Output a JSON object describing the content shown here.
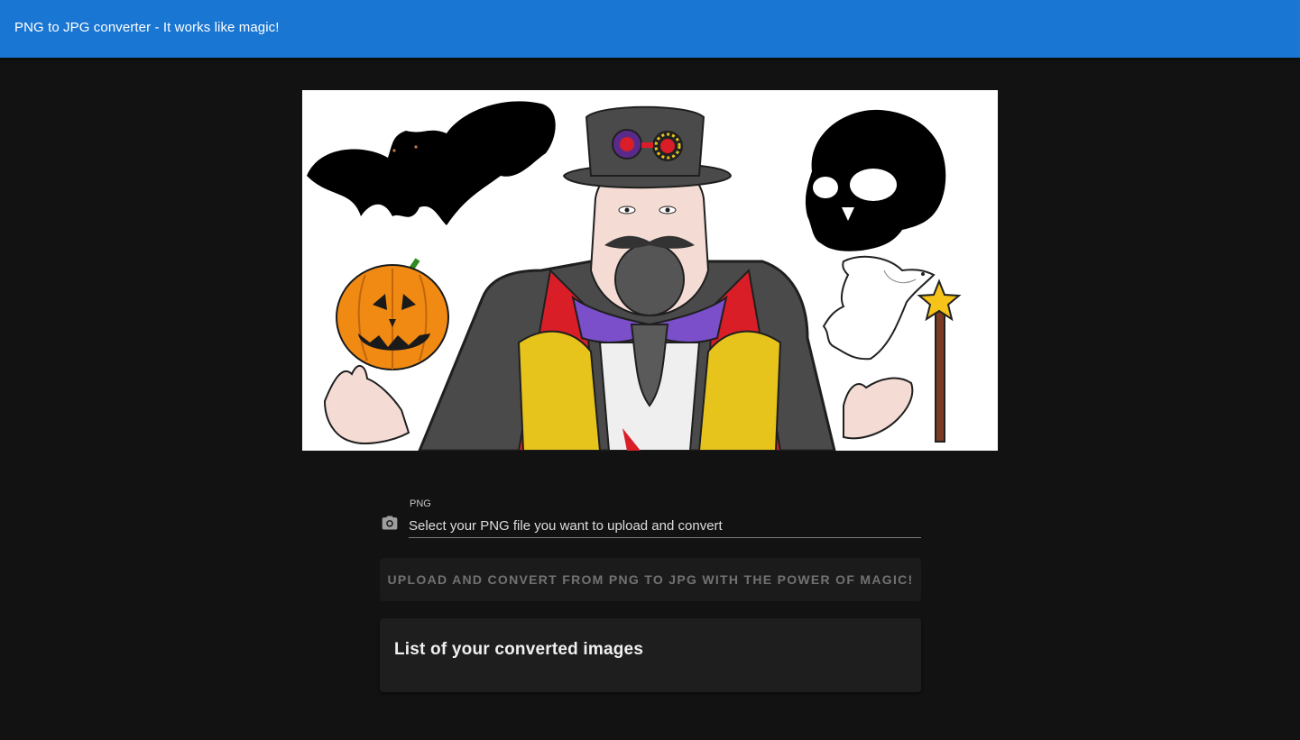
{
  "app": {
    "title": "PNG to JPG converter - It works like magic!"
  },
  "hero": {
    "alt": "Magician illustration with bat, skull, pumpkin, dove and magic wand"
  },
  "upload": {
    "label": "PNG",
    "placeholder": "Select your PNG file you want to upload and convert",
    "value": "",
    "button_label": "UPLOAD AND CONVERT FROM PNG TO JPG WITH THE POWER OF MAGIC!",
    "button_disabled": true
  },
  "converted": {
    "title": "List of your converted images",
    "items": []
  },
  "colors": {
    "app_bar": "#1976d2",
    "background": "#121212",
    "card": "#1e1e1e"
  }
}
